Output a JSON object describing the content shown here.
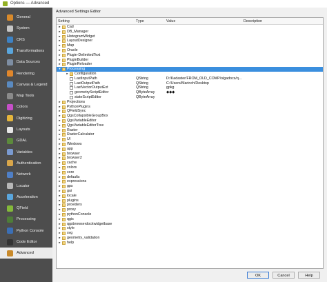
{
  "window": {
    "title": "Options — Advanced"
  },
  "sidebar": {
    "items": [
      {
        "label": "General",
        "icon": "general-icon",
        "color": "#d98a2b"
      },
      {
        "label": "System",
        "icon": "system-icon",
        "color": "#c6c6c6"
      },
      {
        "label": "CRS",
        "icon": "crs-icon",
        "color": "#3d82c4"
      },
      {
        "label": "Transformations",
        "icon": "transformations-icon",
        "color": "#5aa6dd"
      },
      {
        "label": "Data Sources",
        "icon": "data-sources-icon",
        "color": "#7e8ea3"
      },
      {
        "label": "Rendering",
        "icon": "rendering-icon",
        "color": "#e0862b"
      },
      {
        "label": "Canvas & Legend",
        "icon": "canvas-legend-icon",
        "color": "#5a8ac0"
      },
      {
        "label": "Map Tools",
        "icon": "map-tools-icon",
        "color": "#8a8a8a"
      },
      {
        "label": "Colors",
        "icon": "colors-icon",
        "color": "#c64fc8"
      },
      {
        "label": "Digitizing",
        "icon": "digitizing-icon",
        "color": "#e4b53c"
      },
      {
        "label": "Layouts",
        "icon": "layouts-icon",
        "color": "#e6e6e6"
      },
      {
        "label": "GDAL",
        "icon": "gdal-icon",
        "color": "#5c8a3c"
      },
      {
        "label": "Variables",
        "icon": "variables-icon",
        "color": "#7a9ad0"
      },
      {
        "label": "Authentication",
        "icon": "authentication-icon",
        "color": "#d9a64a"
      },
      {
        "label": "Network",
        "icon": "network-icon",
        "color": "#4f7fc6"
      },
      {
        "label": "Locator",
        "icon": "locator-icon",
        "color": "#b7b7b7"
      },
      {
        "label": "Acceleration",
        "icon": "acceleration-icon",
        "color": "#5aa6dd"
      },
      {
        "label": "QField",
        "icon": "qfield-icon",
        "color": "#84b93a"
      },
      {
        "label": "Processing",
        "icon": "processing-icon",
        "color": "#4e7d38"
      },
      {
        "label": "Python Console",
        "icon": "python-console-icon",
        "color": "#3b6fb5"
      },
      {
        "label": "Code Editor",
        "icon": "code-editor-icon",
        "color": "#333333"
      },
      {
        "label": "Advanced",
        "icon": "advanced-icon",
        "color": "#c98a2b"
      }
    ]
  },
  "main": {
    "group_title": "Advanced Settings Editor",
    "columns": {
      "setting": "Setting",
      "type": "Type",
      "value": "Value",
      "description": "Description"
    },
    "rows": [
      {
        "label": "Cad",
        "depth": 0,
        "kind": "folder"
      },
      {
        "label": "DB_Manager",
        "depth": 0,
        "kind": "folder"
      },
      {
        "label": "HistogramWidget",
        "depth": 0,
        "kind": "folder"
      },
      {
        "label": "LayoutDesigner",
        "depth": 0,
        "kind": "folder"
      },
      {
        "label": "Map",
        "depth": 0,
        "kind": "folder"
      },
      {
        "label": "Oracle",
        "depth": 0,
        "kind": "folder"
      },
      {
        "label": "Plugin-DelimitedText",
        "depth": 0,
        "kind": "folder"
      },
      {
        "label": "PluginBuilder",
        "depth": 0,
        "kind": "folder"
      },
      {
        "label": "PluginReloader",
        "depth": 0,
        "kind": "folder"
      },
      {
        "label": "Processing",
        "depth": 0,
        "kind": "folder",
        "expanded": true,
        "selected": true
      },
      {
        "label": "Configuration",
        "depth": 1,
        "kind": "folder"
      },
      {
        "label": "LastInputPath",
        "depth": 1,
        "kind": "leaf",
        "type": "QString",
        "value": "D:/Kadaster/FROM_OLD_COMP/olgadocs/q..."
      },
      {
        "label": "LastOutputPath",
        "depth": 1,
        "kind": "leaf",
        "type": "QString",
        "value": "C:/Users/Marinch/Desktop"
      },
      {
        "label": "LastVectorOutputExt",
        "depth": 1,
        "kind": "leaf",
        "type": "QString",
        "value": "gpkg"
      },
      {
        "label": "geometryScriptEditor",
        "depth": 1,
        "kind": "leaf",
        "type": "QByteArray",
        "value": "◆◆◆"
      },
      {
        "label": "stateScriptEditor",
        "depth": 1,
        "kind": "leaf",
        "type": "QByteArray",
        "value": ""
      },
      {
        "label": "Projections",
        "depth": 0,
        "kind": "folder"
      },
      {
        "label": "PythonPlugins",
        "depth": 0,
        "kind": "folder"
      },
      {
        "label": "QFieldSync",
        "depth": 0,
        "kind": "folder"
      },
      {
        "label": "QgsCollapsibleGroupBox",
        "depth": 0,
        "kind": "folder"
      },
      {
        "label": "QgsVariableEditor",
        "depth": 0,
        "kind": "folder"
      },
      {
        "label": "QgsVariableEditorTree",
        "depth": 0,
        "kind": "folder"
      },
      {
        "label": "Raster",
        "depth": 0,
        "kind": "folder"
      },
      {
        "label": "RasterCalculator",
        "depth": 0,
        "kind": "folder"
      },
      {
        "label": "UI",
        "depth": 0,
        "kind": "folder"
      },
      {
        "label": "Windows",
        "depth": 0,
        "kind": "folder"
      },
      {
        "label": "app",
        "depth": 0,
        "kind": "folder"
      },
      {
        "label": "browser",
        "depth": 0,
        "kind": "folder"
      },
      {
        "label": "browser2",
        "depth": 0,
        "kind": "folder"
      },
      {
        "label": "cache",
        "depth": 0,
        "kind": "folder"
      },
      {
        "label": "colors",
        "depth": 0,
        "kind": "folder"
      },
      {
        "label": "core",
        "depth": 0,
        "kind": "folder"
      },
      {
        "label": "defaults",
        "depth": 0,
        "kind": "folder"
      },
      {
        "label": "expressions",
        "depth": 0,
        "kind": "folder"
      },
      {
        "label": "gps",
        "depth": 0,
        "kind": "folder"
      },
      {
        "label": "gui",
        "depth": 0,
        "kind": "folder"
      },
      {
        "label": "locale",
        "depth": 0,
        "kind": "folder"
      },
      {
        "label": "plugins",
        "depth": 0,
        "kind": "folder"
      },
      {
        "label": "providers",
        "depth": 0,
        "kind": "folder"
      },
      {
        "label": "proxy",
        "depth": 0,
        "kind": "folder"
      },
      {
        "label": "pythonConsole",
        "depth": 0,
        "kind": "folder"
      },
      {
        "label": "qgis",
        "depth": 0,
        "kind": "folder"
      },
      {
        "label": "qgsbrowserdockwidgetbase",
        "depth": 0,
        "kind": "folder"
      },
      {
        "label": "style",
        "depth": 0,
        "kind": "folder"
      },
      {
        "label": "svg",
        "depth": 0,
        "kind": "folder"
      },
      {
        "label": "geometry_validation",
        "depth": 0,
        "kind": "folder"
      },
      {
        "label": "help",
        "depth": 0,
        "kind": "folder"
      }
    ]
  },
  "buttons": {
    "ok": "OK",
    "cancel": "Cancel",
    "help": "Help"
  }
}
